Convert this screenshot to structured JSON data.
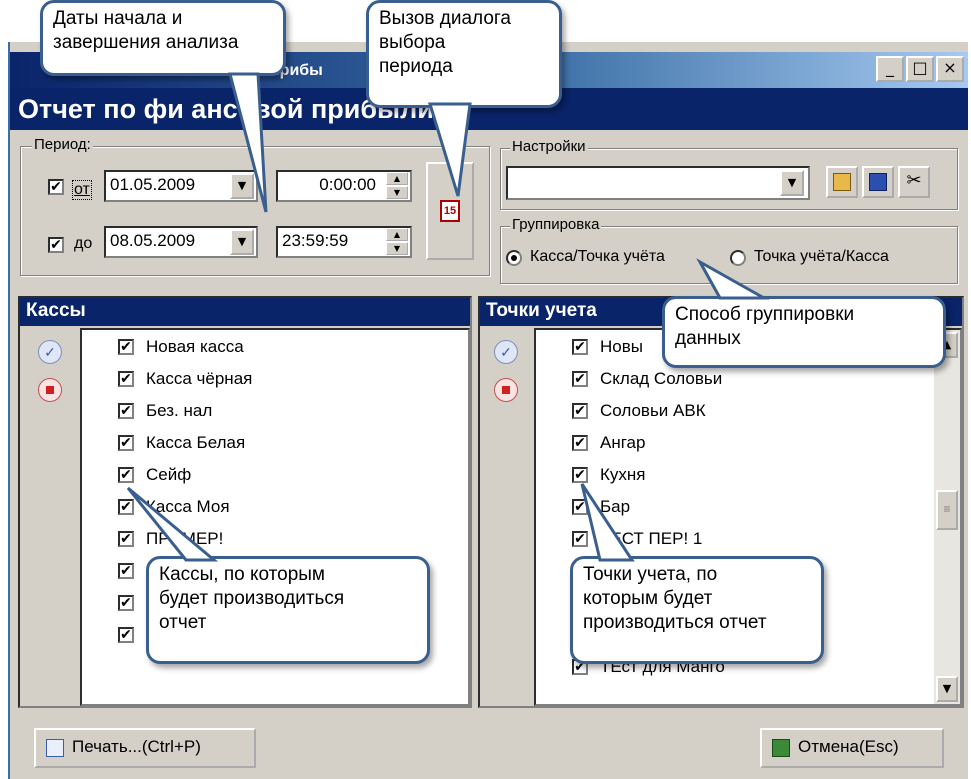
{
  "window": {
    "title": "Отчет по финансовой прибыли",
    "title_visible": "прибы"
  },
  "header": {
    "title": "Отчет по фи ансовой прибыли"
  },
  "period": {
    "label": "Период:",
    "from_label": "от",
    "to_label": "до",
    "from_date": "01.05.2009",
    "from_time": "0:00:00",
    "to_date": "08.05.2009",
    "to_time": "23:59:59",
    "calendar_icon_text": "15"
  },
  "settings": {
    "label": "Настройки",
    "value": ""
  },
  "grouping": {
    "label": "Группировка",
    "option1": "Касса/Точка учёта",
    "option2": "Точка учёта/Касса"
  },
  "cashboxes": {
    "title": "Кассы",
    "items": [
      "Новая касса",
      "Касса чёрная",
      "Без. нал",
      "Касса Белая",
      "Сейф",
      "Касса Моя",
      "ПРИМЕР!",
      "",
      "",
      ""
    ]
  },
  "points": {
    "title": "Точки учета",
    "items": [
      "Новы",
      "Склад Соловьи",
      "Соловьи АВК",
      "Ангар",
      "Кухня",
      "Бар",
      "ТЕСТ ПЕР! 1",
      "",
      "",
      "",
      "ТЕст для Манго"
    ]
  },
  "buttons": {
    "print": "Печать...(Ctrl+P)",
    "cancel": "Отмена(Esc)"
  },
  "callouts": {
    "dates": "Даты начала и\nзавершения анализа",
    "period_dialog": "Вызов диалога\nвыбора\nпериода",
    "grouping": "Способ группировки\nданных",
    "cashboxes": "Кассы, по которым\nбудет производиться\nотчет",
    "points": "Точки учета, по\nкоторым будет\nпроизводиться отчет"
  },
  "colors": {
    "header": "#0a246a",
    "window_bg": "#d4d0c8",
    "callout_border": "#3a5f8f"
  }
}
